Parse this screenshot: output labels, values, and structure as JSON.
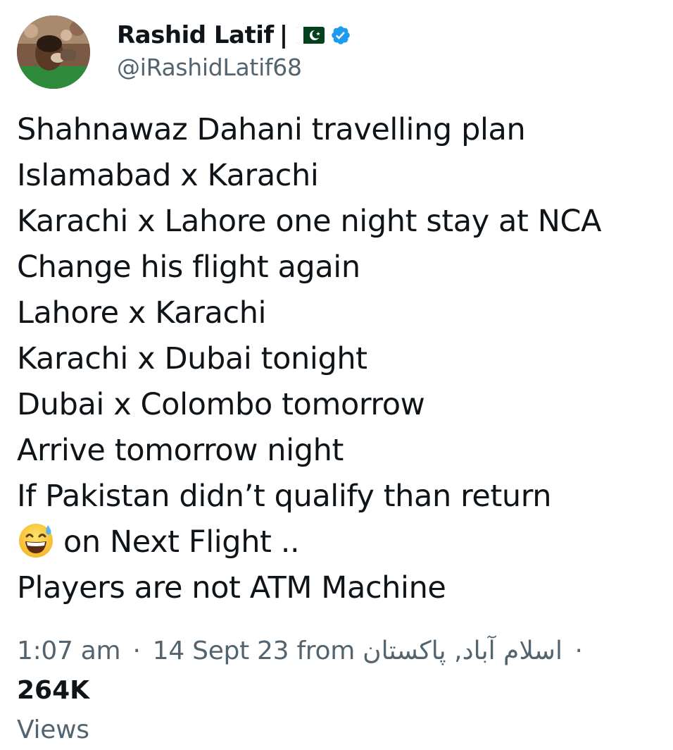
{
  "author": {
    "display_name": "Rashid Latif",
    "name_separator": "|",
    "handle": "@iRashidLatif68",
    "flag_icon": "pakistan-flag-icon",
    "verified_icon": "verified-badge-icon",
    "verified_color": "#1d9bf0"
  },
  "tweet": {
    "lines": [
      "Shahnawaz Dahani travelling plan",
      "Islamabad x Karachi",
      "Karachi x Lahore one night stay at NCA",
      "Change his flight again",
      "Lahore x Karachi",
      "Karachi x Dubai tonight",
      "Dubai x Colombo tomorrow",
      "Arrive tomorrow night",
      "If Pakistan didn’t qualify than return",
      "on Next Flight ..",
      "Players are not ATM Machine"
    ],
    "emoji": "grinning-face-with-sweat-emoji"
  },
  "meta": {
    "time": "1:07 am",
    "dot": "·",
    "date": "14 Sept 23",
    "from_label": "from",
    "location": "اسلام آباد, پاکستان",
    "views_count": "264K",
    "views_label": "Views"
  },
  "colors": {
    "text_primary": "#0f1419",
    "text_secondary": "#536471",
    "verified_blue": "#1d9bf0"
  }
}
